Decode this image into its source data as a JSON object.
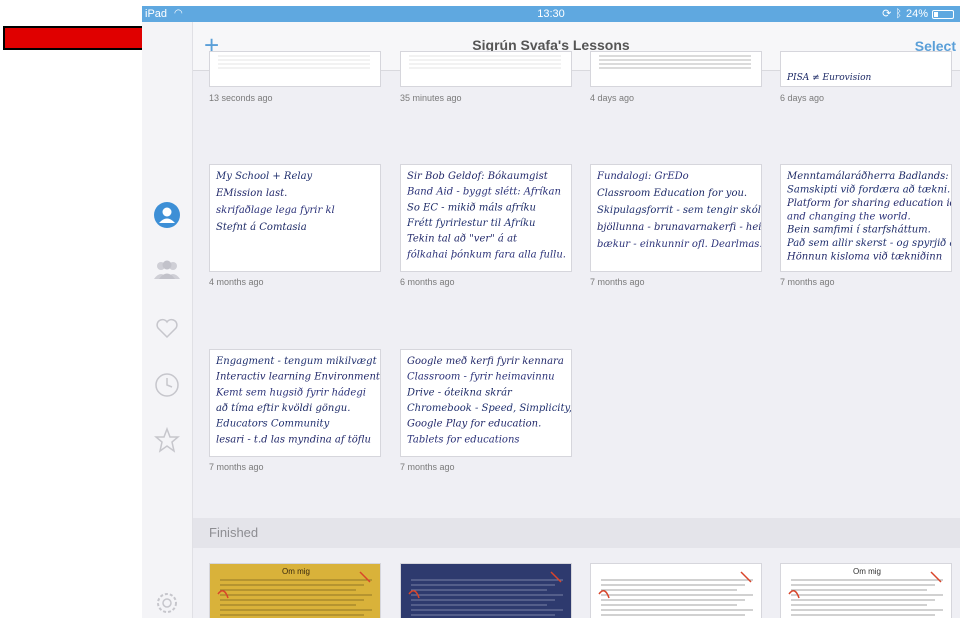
{
  "status_bar": {
    "device": "iPad",
    "time": "13:30",
    "battery": "24%",
    "battery_level": 0.24
  },
  "nav": {
    "add_label": "+",
    "title": "Sigrún Svafa's Lessons",
    "select_label": "Select"
  },
  "sidebar_icons": [
    "profile-icon",
    "group-icon",
    "heart-icon",
    "clock-icon",
    "star-icon",
    "settings-icon"
  ],
  "lessons": [
    {
      "time": "13 seconds ago",
      "text": ""
    },
    {
      "time": "35 minutes ago",
      "text": ""
    },
    {
      "time": "4 days ago",
      "text": ""
    },
    {
      "time": "6 days ago",
      "text": "PISA ≠ Eurovision"
    },
    {
      "time": "4 months ago",
      "text": "My School + Relay\nEMission last.\nskrifaðlage lega fyrir kl\nStefnt á Comtasia"
    },
    {
      "time": "6 months ago",
      "text": "Sir Bob Geldof: Bókaumgist\nBand Aid - byggt slétt: Afríkan\nSo EC - mikið máls afríku\nFrétt fyrirlestur til Afríku\nTekin tal að \"ver\" á at\nfólkahai þónkum fara alla fullu."
    },
    {
      "time": "7 months ago",
      "text": "Fundalogi: GrEDo\nClassroom Education for you.\nSkipulagsforrit - sem tengir skóla\nbjöllunna - brunavarnakerfi - heimasíð\nbækur - einkunnir ofl. Dearlmas."
    },
    {
      "time": "7 months ago",
      "text": "Menntamálaráðherra Badlands:\nSamskipti við fordæra að tækni.\nPlatform for sharing education ideas\nand changing the world.\nBein samfimi í starfsháttum.\nPað sem allir skerst - og spyrjið af hverju.\nHönnun kisloma við tækniðinn"
    },
    {
      "time": "7 months ago",
      "text": "Engagment - tengum mikilvægt\nInteractiv learning Environment\nKemt sem hugsið fyrir hádegi\nað tíma eftir kvöldi göngu.\nEducators Community\nlesari - t.d las myndina af töflu"
    },
    {
      "time": "7 months ago",
      "text": "Google með kerfi fyrir kennara\nClassroom - fyrir heimavinnu\nDrive - óteikna skrár\nChromebook - Speed, Simplicity, durable\nGoogle Play for education.\nTablets for educations"
    }
  ],
  "finished_section": {
    "header": "Finished",
    "items": [
      {
        "title": "Om mig"
      },
      {
        "title": ""
      },
      {
        "title": ""
      },
      {
        "title": "Om mig"
      }
    ]
  }
}
